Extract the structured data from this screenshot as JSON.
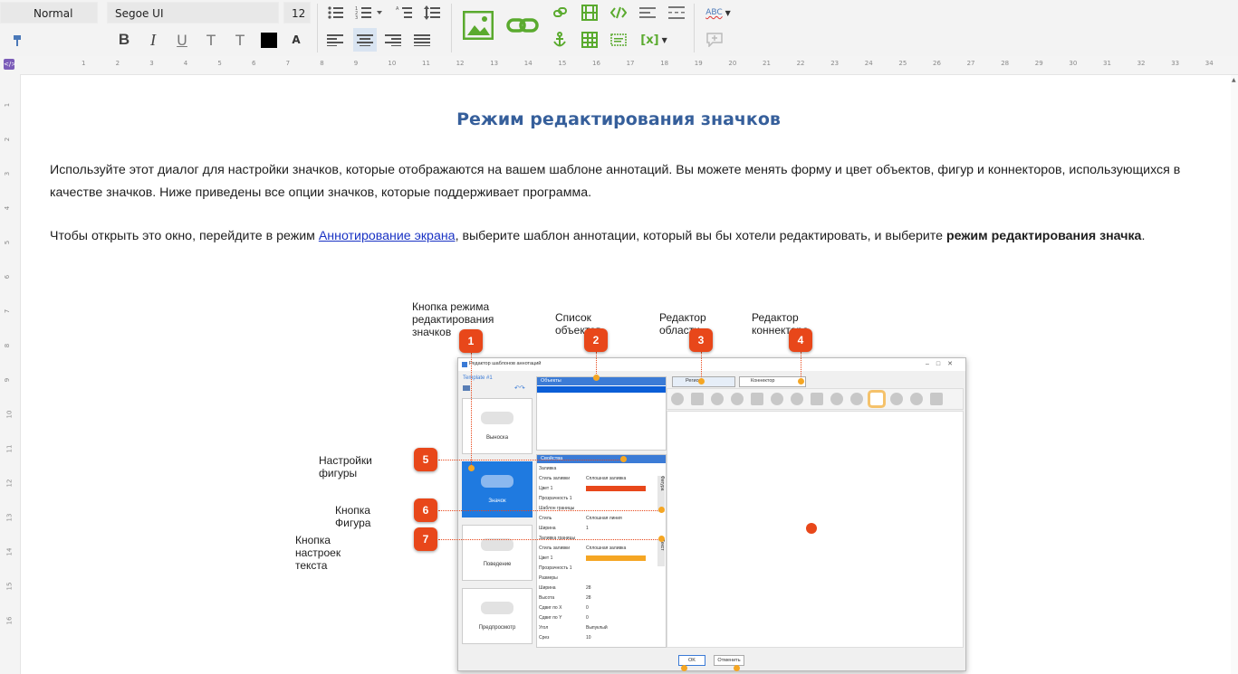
{
  "toolbar": {
    "style_value": "Normal",
    "font_value": "Segoe UI",
    "size_value": "12",
    "bold_label": "B",
    "italic_label": "I",
    "underline_label": "U",
    "subscript_label": "T",
    "superscript_label": "T",
    "highlight_label": "A",
    "spell_label": "ABC",
    "var_label": "[x]"
  },
  "ruler": {
    "numbers": [
      "1",
      "2",
      "3",
      "4",
      "5",
      "6",
      "7",
      "8",
      "9",
      "10",
      "11",
      "12",
      "13",
      "14",
      "15",
      "16",
      "17",
      "18",
      "19",
      "20",
      "21",
      "22",
      "23",
      "24",
      "25",
      "26",
      "27",
      "28",
      "29",
      "30",
      "31",
      "32",
      "33",
      "34"
    ],
    "vnumbers": [
      "1",
      "2",
      "3",
      "4",
      "5",
      "6",
      "7",
      "8",
      "9",
      "10",
      "11",
      "12",
      "13",
      "14",
      "15",
      "16"
    ]
  },
  "document": {
    "title": "Режим редактирования значков",
    "para1": "Используйте этот диалог для настройки значков, которые отображаются на вашем шаблоне аннотаций. Вы можете менять форму и цвет объектов, фигур и коннекторов, использующихся в качестве значков. Ниже приведены все опции значков, которые поддерживает программа.",
    "para2_before": "Чтобы открыть это окно, перейдите в режим ",
    "para2_link": "Аннотирование экрана",
    "para2_middle": ", выберите шаблон аннотации, который вы бы хотели редактировать, и выберите ",
    "para2_bold": "режим редактирования значка",
    "para2_end": "."
  },
  "figure": {
    "cap1_line1": "Кнопка режима",
    "cap1_line2": "редактирования значков",
    "cap2": "Список объектов",
    "cap3": "Редактор области",
    "cap4": "Редактор коннектора",
    "cap5": "Настройки фигуры",
    "cap6": "Кнопка Фигура",
    "cap7": "Кнопка настроек текста",
    "badges": [
      "1",
      "2",
      "3",
      "4",
      "5",
      "6",
      "7"
    ],
    "window": {
      "title": "Редактор шаблонов аннотаций",
      "template": "Template #1",
      "objects_hdr": "Объекты",
      "props_hdr": "Свойства",
      "tab_region": "Регион",
      "tab_connector": "Коннектор",
      "tiles": [
        "Выноска",
        "Значок",
        "Поведение",
        "Предпросмотр"
      ],
      "props": [
        "Заливка",
        "Стиль заливки",
        "Цвет 1",
        "Прозрачность 1",
        "Шаблон границы",
        "Стиль",
        "Ширина",
        "Заливка границы",
        "Стиль заливки",
        "Цвет 1",
        "Прозрачность 1",
        "Размеры",
        "Ширина",
        "Высота",
        "Сдвиг по X",
        "Сдвиг по Y",
        "Угол",
        "Срез"
      ],
      "prop_values": [
        "",
        "Сплошная заливка",
        "",
        "",
        "",
        "Сплошная линия",
        "1",
        "",
        "Сплошная заливка",
        "",
        "",
        "",
        "28",
        "28",
        "0",
        "0",
        "Выпуклый",
        "10"
      ],
      "side_tab1": "Фигура",
      "side_tab2": "Текст",
      "ok": "OK",
      "cancel": "Отменить"
    }
  },
  "colors": {
    "title": "#365f9b",
    "badge": "#e8471a",
    "link": "#1a33c4",
    "accent_green": "#5aaa2e",
    "panel_blue": "#3b7bd6"
  }
}
